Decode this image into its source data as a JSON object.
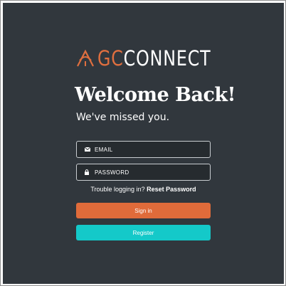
{
  "brand": {
    "logo_prefix": "GC",
    "logo_suffix": "CONNECT",
    "logo_icon": "tent-icon",
    "accent_color": "#e06f3f"
  },
  "heading": {
    "title": "Welcome Back!",
    "subtitle": "We've missed you."
  },
  "form": {
    "email": {
      "placeholder": "EMAIL",
      "value": "",
      "icon": "envelope-icon"
    },
    "password": {
      "placeholder": "PASSWORD",
      "value": "",
      "icon": "lock-icon"
    },
    "trouble_text": "Trouble logging in?",
    "reset_link": "Reset Password",
    "signin_label": "Sign in",
    "register_label": "Register"
  },
  "colors": {
    "background": "#31373d",
    "signin": "#e06b3a",
    "register": "#14c9c9"
  }
}
